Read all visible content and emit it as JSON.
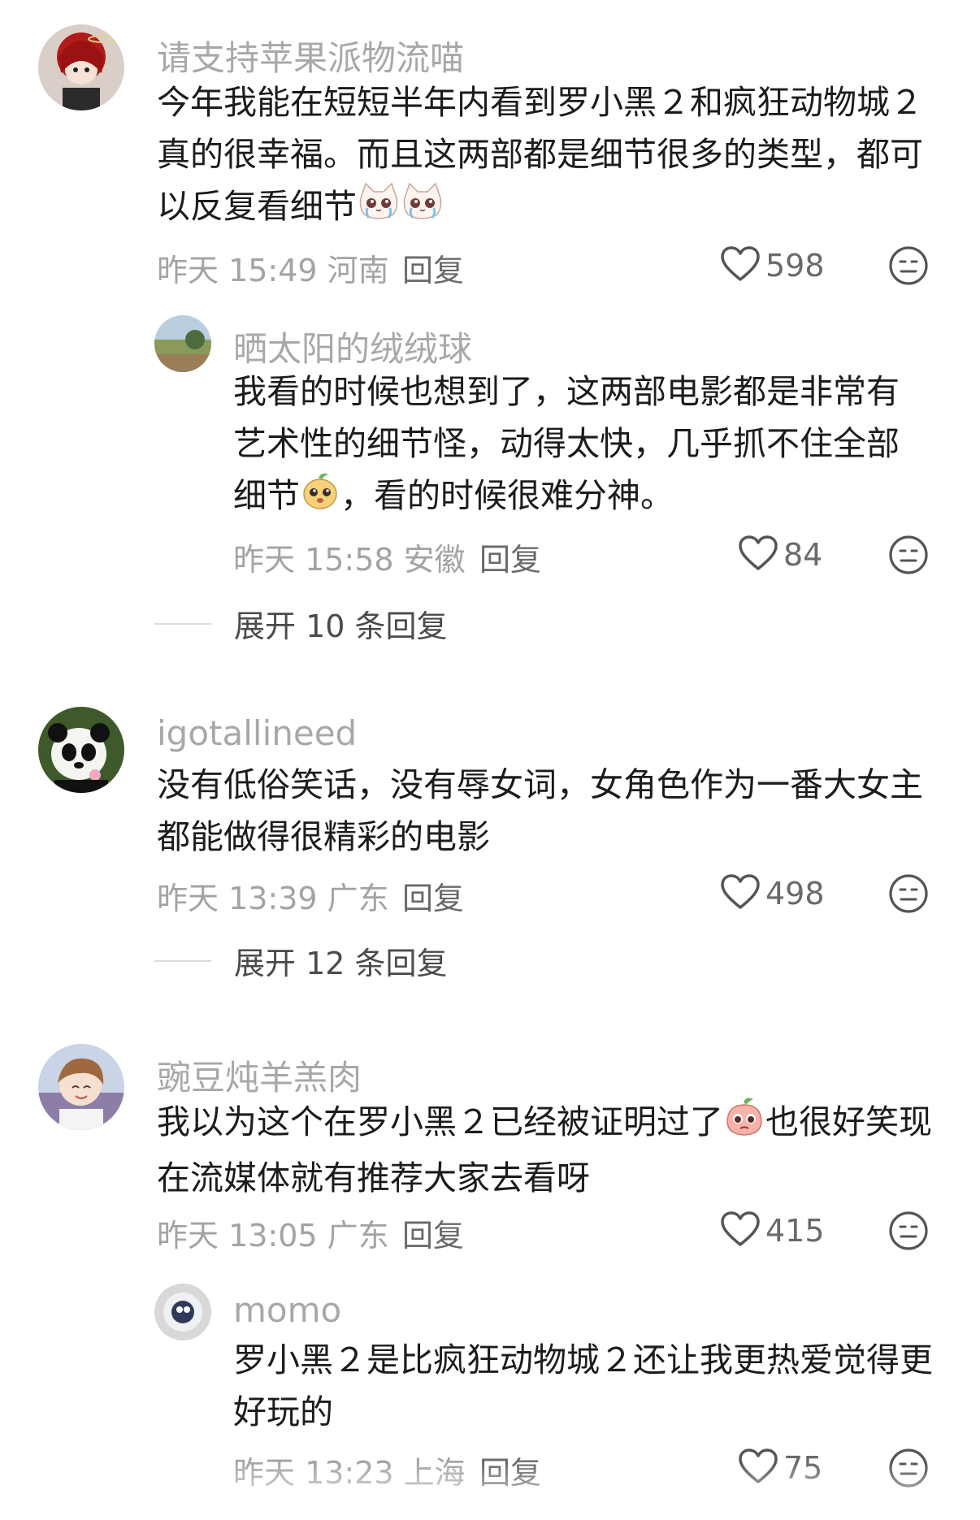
{
  "comments": [
    {
      "user": "请支持苹果派物流喵",
      "lines": [
        "今年我能在短短半年内看到罗小黑２和疯狂动物城２",
        "真的很幸福。而且这两部都是细节很多的类型，都可",
        "以反复看细节"
      ],
      "time": "昨天 15:49 河南",
      "reply_label": "回复",
      "likes": "598",
      "replies": [
        {
          "user": "晒太阳的绒绒球",
          "lines": [
            "我看的时候也想到了，这两部电影都是非常有",
            "艺术性的细节怪，动得太快，几乎抓不住全部",
            "细节",
            "，看的时候很难分神。"
          ],
          "time": "昨天 15:58 安徽",
          "reply_label": "回复",
          "likes": "84"
        }
      ],
      "expand_label": "展开 10 条回复"
    },
    {
      "user": "igotallineed",
      "lines": [
        "没有低俗笑话，没有辱女词，女角色作为一番大女主",
        "都能做得很精彩的电影"
      ],
      "time": "昨天 13:39 广东",
      "reply_label": "回复",
      "likes": "498",
      "expand_label": "展开 12 条回复"
    },
    {
      "user": "豌豆炖羊羔肉",
      "lines": [
        "我以为这个在罗小黑２已经被证明过了",
        "也很好笑现",
        "在流媒体就有推荐大家去看呀"
      ],
      "time": "昨天 13:05 广东",
      "reply_label": "回复",
      "likes": "415",
      "replies": [
        {
          "user": "momo",
          "lines": [
            "罗小黑２是比疯狂动物城２还让我更热爱觉得更",
            "好玩的"
          ],
          "time": "昨天 13:23 上海",
          "reply_label": "回复",
          "likes": "75"
        }
      ]
    }
  ],
  "icons": {
    "like": "heart-outline-icon",
    "dislike": "neutral-face-icon",
    "emoji_cat": "crying-cat-emoji",
    "emoji_fruit": "peach-face-emoji",
    "emoji_peach": "pleading-peach-emoji"
  },
  "colors": {
    "username": "#a8a8a8",
    "meta": "#a3a3a3",
    "text": "#1c1c1c"
  }
}
